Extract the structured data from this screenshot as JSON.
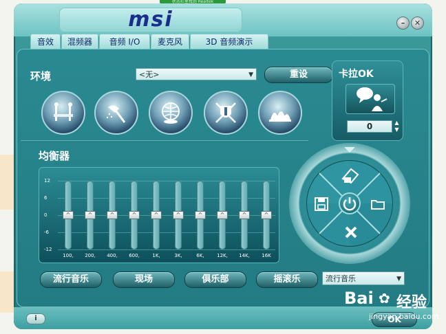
{
  "header": {
    "logo_text": "msi",
    "topcap_text": "状态栏里找到 Realtek"
  },
  "window_buttons": {
    "minimize_symbol": "–",
    "close_symbol": "✕"
  },
  "tabs": [
    {
      "label": "音效"
    },
    {
      "label": "混频器"
    },
    {
      "label": "音频 I/O"
    },
    {
      "label": "麦克风"
    },
    {
      "label": "3D 音频演示"
    }
  ],
  "environment": {
    "label": "环境",
    "select_value": "<无>",
    "reset_label": "重设",
    "presets": [
      {
        "icon": "bathroom-icon"
      },
      {
        "icon": "shower-icon"
      },
      {
        "icon": "globe-icon"
      },
      {
        "icon": "castle-shield-icon"
      },
      {
        "icon": "opera-house-icon"
      }
    ]
  },
  "equalizer": {
    "label": "均衡器",
    "y_labels": [
      "12",
      "6",
      "0",
      "-6",
      "-12"
    ],
    "bands": [
      {
        "label": "100,",
        "gain_db": 0
      },
      {
        "label": "200,",
        "gain_db": 0
      },
      {
        "label": "400,",
        "gain_db": 0
      },
      {
        "label": "600,",
        "gain_db": 0
      },
      {
        "label": "1K,",
        "gain_db": 0
      },
      {
        "label": "3K,",
        "gain_db": 0
      },
      {
        "label": "6K,",
        "gain_db": 0
      },
      {
        "label": "12K,",
        "gain_db": 0
      },
      {
        "label": "14K,",
        "gain_db": 0
      },
      {
        "label": "16K",
        "gain_db": 0
      }
    ],
    "preset_buttons": [
      {
        "label": "流行音乐"
      },
      {
        "label": "现场"
      },
      {
        "label": "俱乐部"
      },
      {
        "label": "摇滚乐"
      }
    ],
    "preset_select_value": "流行音乐"
  },
  "karaoke": {
    "label": "卡拉OK",
    "value": "0",
    "icon": "karaoke-singer-icon"
  },
  "control_wheel": {
    "center_icon": "power-icon",
    "icons": [
      "erase-icon",
      "save-icon",
      "folder-icon",
      "delete-icon"
    ]
  },
  "footer": {
    "info_label": "i",
    "ok_label": "OK"
  },
  "watermark": {
    "brand": "Bai",
    "brand2": "经验",
    "url": "jingyan.baidu.com"
  },
  "colors": {
    "accent": "#2e8a8b",
    "text": "#ffffff",
    "logo": "#1a2e8c"
  }
}
